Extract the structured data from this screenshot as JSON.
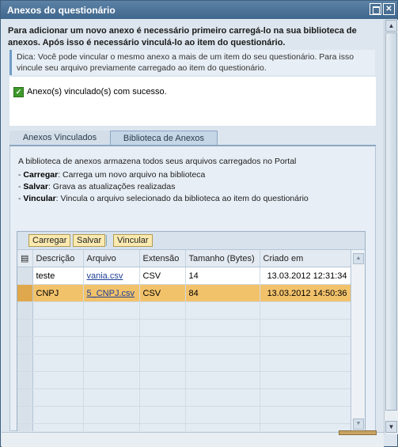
{
  "window": {
    "title": "Anexos do questionário"
  },
  "info": {
    "heading": "Para adicionar um novo anexo é necessário primeiro carregá-lo na sua biblioteca de anexos. Após isso é necessário vinculá-lo ao item do questionário.",
    "tip": "Dica: Você pode vincular o mesmo anexo a mais de um item do seu questionário. Para isso vincule seu arquivo previamente carregado ao item do questionário."
  },
  "message": {
    "text": "Anexo(s) vinculado(s) com sucesso.",
    "status_color": "#3e9a2b"
  },
  "tabs": [
    {
      "label": "Anexos Vinculados",
      "active": false
    },
    {
      "label": "Biblioteca de Anexos",
      "active": true
    }
  ],
  "library": {
    "intro": "A biblioteca de anexos armazena todos seus arquivos carregados no Portal",
    "items": [
      {
        "term": "Carregar",
        "text": ": Carrega um novo arquivo na biblioteca"
      },
      {
        "term": "Salvar",
        "text": ": Grava as atualizações realizadas"
      },
      {
        "term": "Vincular",
        "text": ": Vincula o arquivo selecionado da biblioteca ao item do questionário"
      }
    ]
  },
  "toolbar": {
    "upload": "Carregar",
    "save": "Salvar",
    "link": "Vincular"
  },
  "table": {
    "columns": [
      "Descrição",
      "Arquivo",
      "Extensão",
      "Tamanho (Bytes)",
      "Criado em"
    ],
    "rows": [
      {
        "descricao": "teste",
        "arquivo": "vania.csv",
        "extensao": "CSV",
        "tamanho": "14",
        "criado": "13.03.2012 12:31:34",
        "selected": false
      },
      {
        "descricao": "CNPJ",
        "arquivo": "5_CNPJ.csv",
        "extensao": "CSV",
        "tamanho": "84",
        "criado": "13.03.2012 14:50:36",
        "selected": true
      }
    ],
    "highlight_color": "#f2c26b"
  }
}
